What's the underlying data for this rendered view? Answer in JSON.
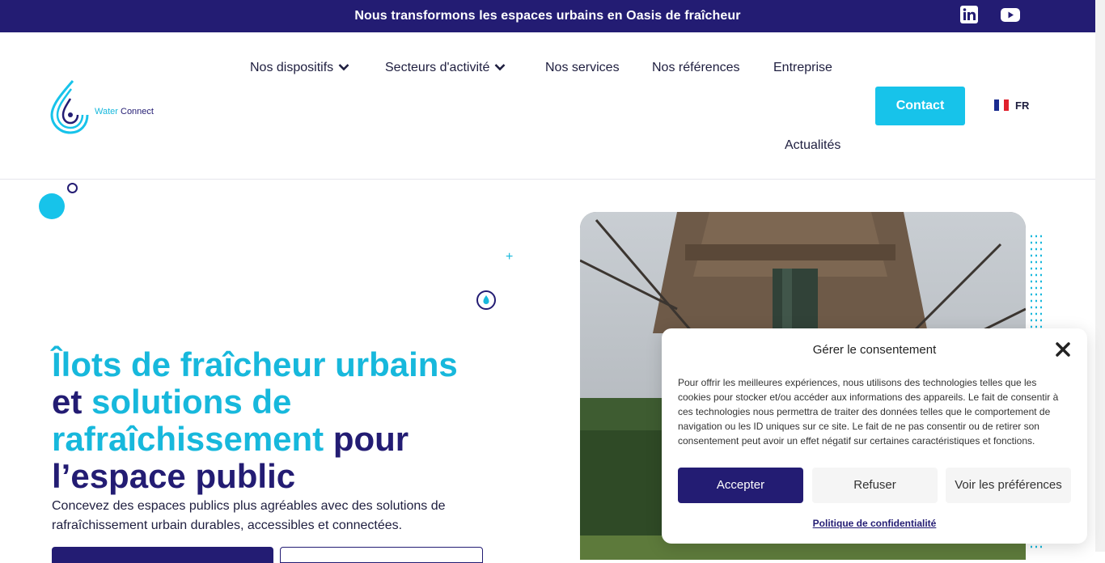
{
  "topbar": {
    "message": "Nous transformons les espaces urbains en Oasis de fraîcheur",
    "linkedin_icon": "linkedin-icon",
    "youtube_icon": "youtube-icon"
  },
  "header": {
    "logo_text_1": "Water",
    "logo_text_2": "Connect",
    "nav": {
      "dispositifs": "Nos dispositifs",
      "secteurs": "Secteurs d'activité",
      "services": "Nos services",
      "references": "Nos références",
      "entreprise": "Entreprise",
      "actualites": "Actualités"
    },
    "contact_label": "Contact",
    "language": "FR"
  },
  "hero": {
    "headline": {
      "p1": "Îlots de fraîcheur urbains",
      "p2": "et",
      "p3": "solutions de rafraîchissement",
      "p4": "pour l’espace public"
    },
    "subtitle": "Concevez des espaces publics plus agréables avec des solutions de rafraîchissement urbain durables, accessibles et connectées."
  },
  "consent": {
    "title": "Gérer le consentement",
    "text": "Pour offrir les meilleures expériences, nous utilisons des technologies telles que les cookies pour stocker et/ou accéder aux informations des appareils. Le fait de consentir à ces technologies nous permettra de traiter des données telles que le comportement de navigation ou les ID uniques sur ce site. Le fait de ne pas consentir ou de retirer son consentement peut avoir un effet négatif sur certaines caractéristiques et fonctions.",
    "accept": "Accepter",
    "refuse": "Refuser",
    "preferences": "Voir les préférences",
    "policy": "Politique de confidentialité"
  },
  "colors": {
    "brand_navy": "#231c73",
    "brand_cyan": "#17c3ea"
  }
}
